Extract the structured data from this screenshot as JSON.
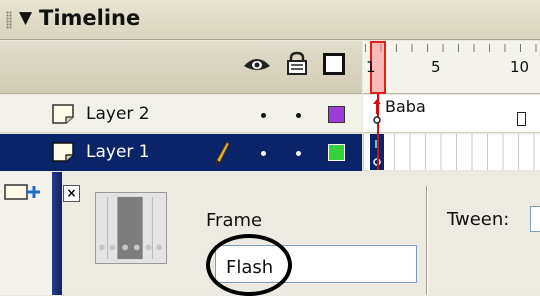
{
  "panel": {
    "arrow": "▼",
    "title": "Timeline"
  },
  "header": {
    "icons": [
      "eye-icon",
      "lock-icon",
      "outline-icon"
    ]
  },
  "ruler": {
    "labels": [
      "1",
      "5",
      "10"
    ]
  },
  "layers": [
    {
      "name": "Layer 2",
      "selected": false,
      "has_pencil": false,
      "color": "#9b3dd6",
      "frame_label": "Baba"
    },
    {
      "name": "Layer 1",
      "selected": true,
      "has_pencil": true,
      "color": "#33d13a"
    }
  ],
  "properties": {
    "close_glyph": "×",
    "frame_caption": "Frame",
    "frame_name_value": "Flash",
    "tween_label": "Tween:"
  },
  "colors": {
    "selection": "#0a246a",
    "playhead": "#e0201a"
  }
}
